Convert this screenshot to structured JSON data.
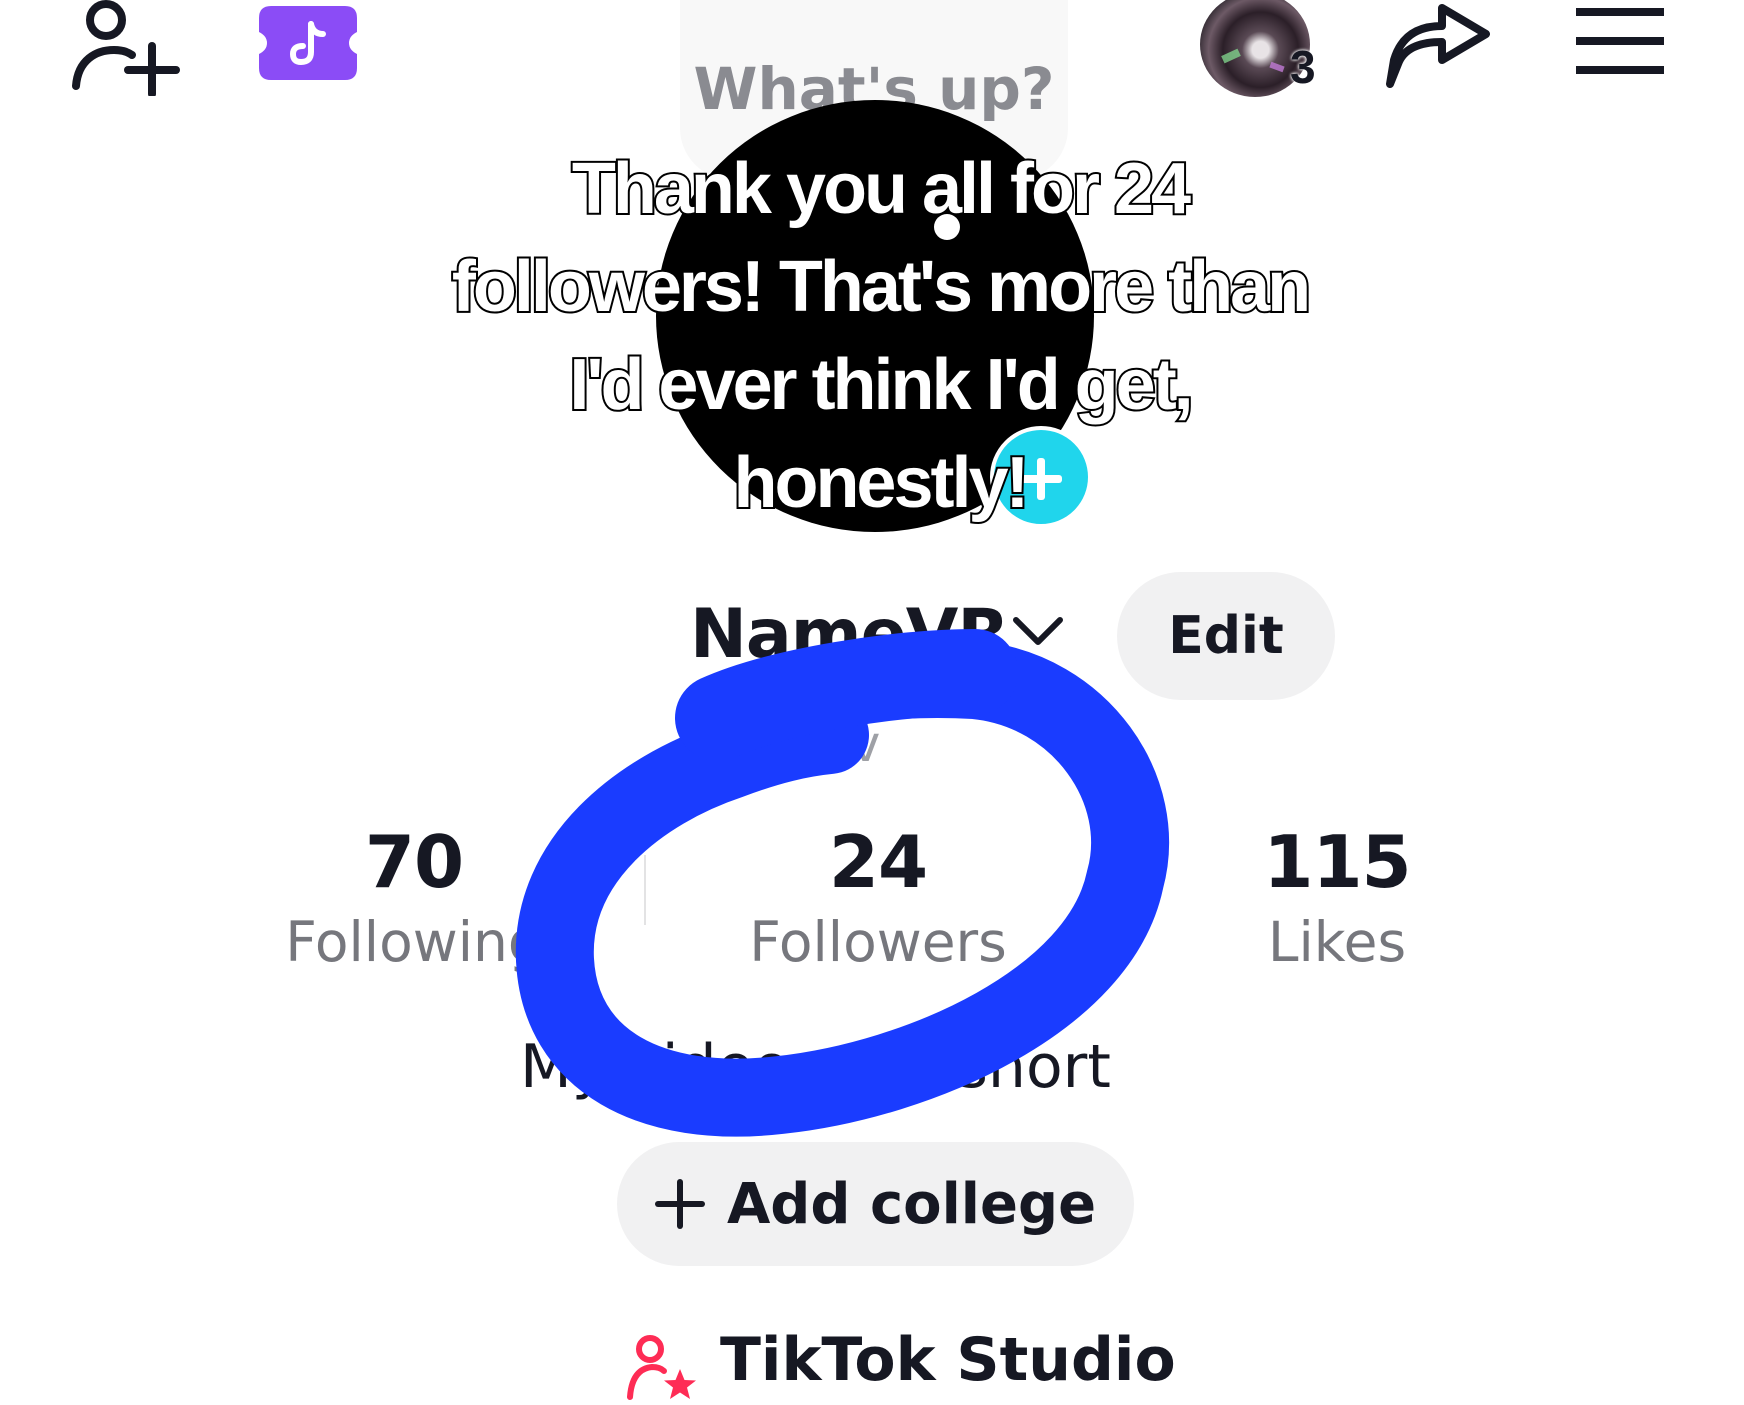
{
  "header": {
    "avatar_badge_count": "3",
    "status_placeholder": "What's up?"
  },
  "caption": {
    "lines": [
      "Thank you all for 24",
      "followers! That's more than",
      "I'd ever think I'd get,",
      "honestly!"
    ]
  },
  "profile": {
    "username": "NameVR",
    "edit_label": "Edit",
    "handle_partial": "ev",
    "bio": "My videos are short"
  },
  "stats": [
    {
      "value": "70",
      "label": "Following"
    },
    {
      "value": "24",
      "label": "Followers"
    },
    {
      "value": "115",
      "label": "Likes"
    }
  ],
  "actions": {
    "add_college_label": "Add college",
    "studio_label": "TikTok Studio"
  },
  "colors": {
    "text_primary": "#161823",
    "text_secondary": "#76777d",
    "pill_background": "#f1f1f2",
    "ticket_purple": "#8b4cf6",
    "add_photo_cyan": "#20d5ec",
    "studio_pink": "#fe2c55",
    "marker_blue": "#1a3cff"
  },
  "icons": {
    "add_friend": "add-friend-icon",
    "ticket": "tiktok-ticket-icon",
    "share": "share-arrow-icon",
    "menu": "hamburger-menu-icon",
    "chevron": "chevron-down-icon",
    "plus": "plus-icon",
    "studio": "creator-star-icon"
  }
}
